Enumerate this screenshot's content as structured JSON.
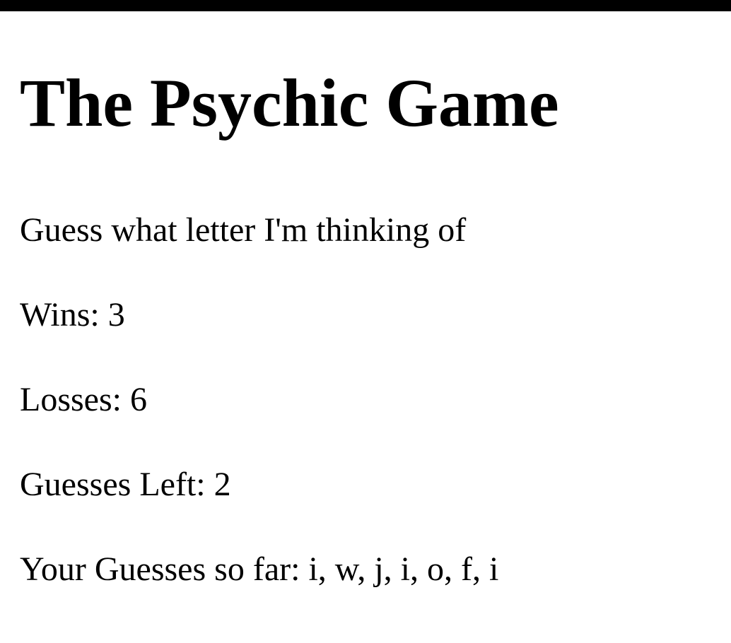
{
  "page": {
    "title": "The Psychic Game",
    "instructions": "Guess what letter I'm thinking of",
    "wins_text": "Wins: 3",
    "losses_text": "Losses: 6",
    "guesses_left_text": "Guesses Left: 2",
    "guesses_so_far_text": "Your Guesses so far: i, w, j, i, o, f, i"
  },
  "colors": {
    "background": "#ffffff",
    "text": "#000000",
    "top_bar": "#000000"
  }
}
